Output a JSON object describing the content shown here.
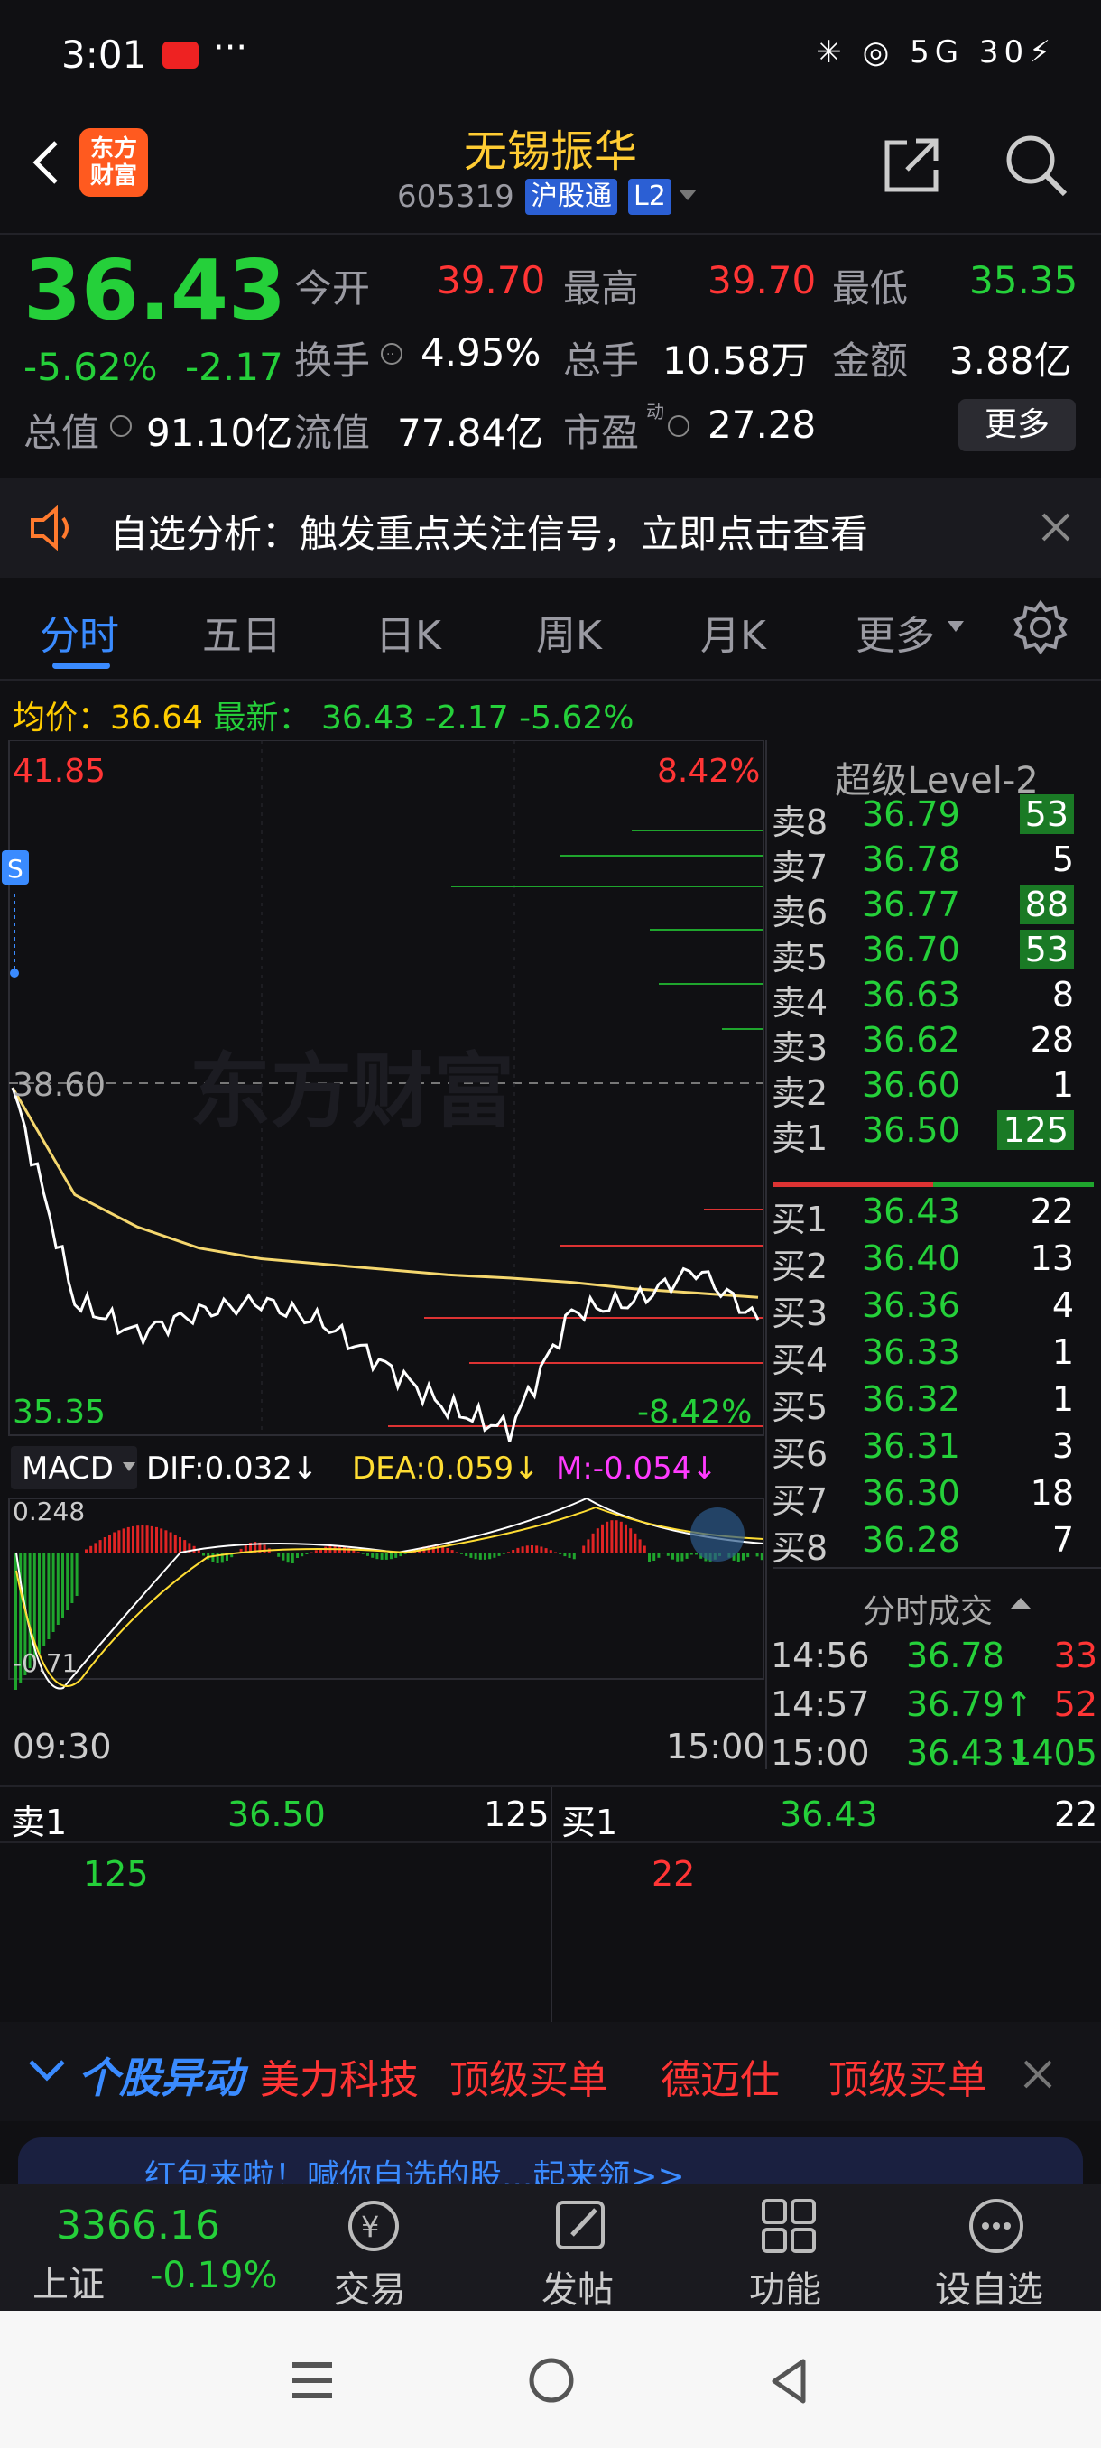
{
  "status": {
    "time": "3:01",
    "dots": "···",
    "icons": "✳ ◎ 5G 30⚡",
    "battery": "30",
    "signal": "5G"
  },
  "header": {
    "logo_line1": "东方",
    "logo_line2": "财富",
    "stock_name": "无锡振华",
    "stock_code": "605319",
    "tag_market": "沪股通",
    "tag_level": "L2"
  },
  "quote": {
    "price": "36.43",
    "change_pct": "-5.62%",
    "change": "-2.17",
    "open_label": "今开",
    "open": "39.70",
    "high_label": "最高",
    "high": "39.70",
    "low_label": "最低",
    "low": "35.35",
    "turnover_label": "换手",
    "turnover": "4.95%",
    "volume_label": "总手",
    "volume": "10.58万",
    "amount_label": "金额",
    "amount": "3.88亿",
    "mcap_label": "总值",
    "mcap": "91.10亿",
    "float_label": "流值",
    "float": "77.84亿",
    "pe_label": "市盈",
    "pe_sup": "动",
    "pe": "27.28",
    "more": "更多"
  },
  "alert": {
    "text": "自选分析：触发重点关注信号，立即点击查看"
  },
  "tabs": [
    "分时",
    "五日",
    "日K",
    "周K",
    "月K",
    "更多"
  ],
  "summary_line": {
    "avg_label": "均价：",
    "avg": "36.64",
    "latest_label": "最新：",
    "latest": "36.43",
    "change": "-2.17",
    "change_pct": "-5.62%"
  },
  "chart": {
    "y_top": "41.85",
    "pct_top": "8.42%",
    "y_mid": "38.60",
    "y_bottom": "35.35",
    "pct_bottom": "-8.42%",
    "s_marker": "S",
    "watermark": "东方财富",
    "macd_label": "MACD",
    "dif": "DIF:0.032↓",
    "dea": "DEA:0.059↓",
    "m": "M:-0.054↓",
    "macd_top": "0.248",
    "macd_bottom": "-0.71",
    "time_start": "09:30",
    "time_end": "15:00"
  },
  "chart_data": {
    "type": "line",
    "series": [
      {
        "name": "均价",
        "values": [
          38.6,
          37.6,
          37.3,
          37.1,
          37.0,
          36.95,
          36.9,
          36.85,
          36.82,
          36.78,
          36.72,
          36.68,
          36.64
        ]
      },
      {
        "name": "最新",
        "values": [
          38.6,
          36.6,
          36.3,
          36.5,
          36.6,
          36.4,
          36.0,
          35.6,
          35.4,
          36.5,
          36.6,
          36.9,
          36.43
        ]
      }
    ],
    "ylim": [
      35.35,
      41.85
    ]
  },
  "orderbook": {
    "title": "超级Level-2",
    "asks": [
      {
        "label": "卖8",
        "price": "36.79",
        "vol": "53"
      },
      {
        "label": "卖7",
        "price": "36.78",
        "vol": "5"
      },
      {
        "label": "卖6",
        "price": "36.77",
        "vol": "88"
      },
      {
        "label": "卖5",
        "price": "36.70",
        "vol": "53"
      },
      {
        "label": "卖4",
        "price": "36.63",
        "vol": "8"
      },
      {
        "label": "卖3",
        "price": "36.62",
        "vol": "28"
      },
      {
        "label": "卖2",
        "price": "36.60",
        "vol": "1"
      },
      {
        "label": "卖1",
        "price": "36.50",
        "vol": "125"
      }
    ],
    "bids": [
      {
        "label": "买1",
        "price": "36.43",
        "vol": "22"
      },
      {
        "label": "买2",
        "price": "36.40",
        "vol": "13"
      },
      {
        "label": "买3",
        "price": "36.36",
        "vol": "4"
      },
      {
        "label": "买4",
        "price": "36.33",
        "vol": "1"
      },
      {
        "label": "买5",
        "price": "36.32",
        "vol": "1"
      },
      {
        "label": "买6",
        "price": "36.31",
        "vol": "3"
      },
      {
        "label": "买7",
        "price": "36.30",
        "vol": "18"
      },
      {
        "label": "买8",
        "price": "36.28",
        "vol": "7"
      }
    ],
    "trades_title": "分时成交",
    "trades": [
      {
        "time": "14:56",
        "price": "36.78",
        "vol": "33"
      },
      {
        "time": "14:57",
        "price": "36.79↑",
        "vol": "52"
      },
      {
        "time": "15:00",
        "price": "36.43↓",
        "vol": "1405"
      }
    ]
  },
  "queue": {
    "ask_label": "卖1",
    "ask_price": "36.50",
    "ask_total": "125",
    "ask_item": "125",
    "bid_label": "买1",
    "bid_price": "36.43",
    "bid_total": "22",
    "bid_item": "22"
  },
  "ticker": {
    "title": "个股异动",
    "item1": "美力科技",
    "item2": "顶级买单",
    "item3": "德迈仕",
    "item4": "顶级买单"
  },
  "banner": {
    "text": "红包来啦！喊你自选的股...起来领>>"
  },
  "bottom_nav": {
    "index_value": "3366.16",
    "index_name": "上证",
    "index_change": "-0.19%",
    "trade": "交易",
    "post": "发帖",
    "func": "功能",
    "watch": "设自选"
  }
}
